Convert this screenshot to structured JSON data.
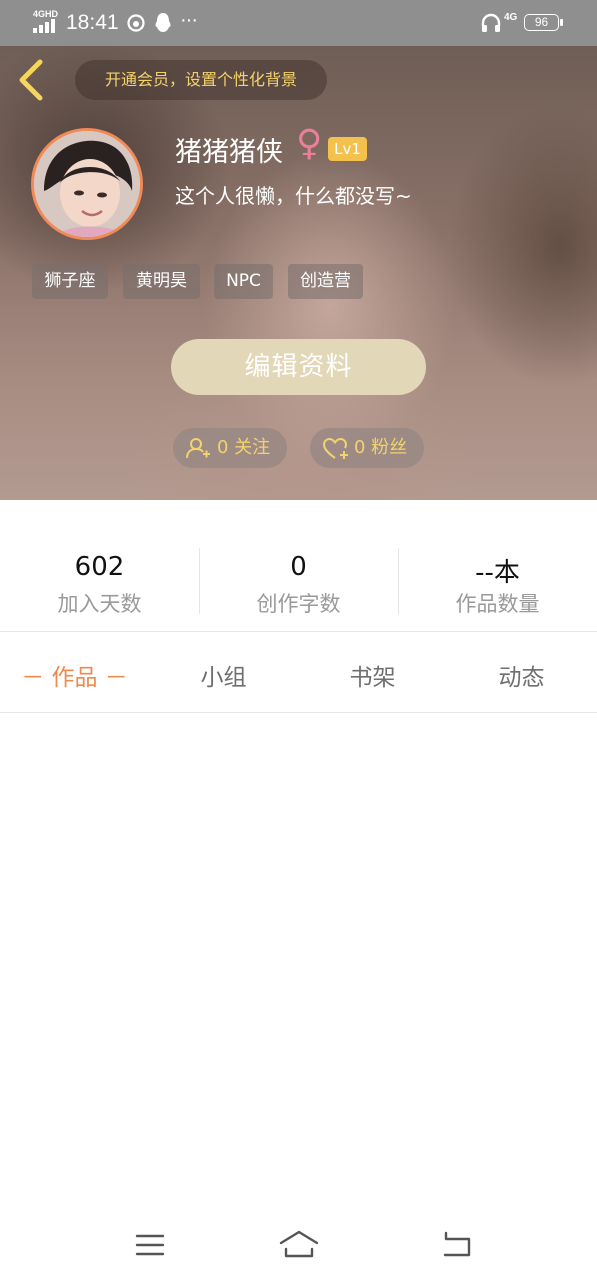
{
  "status_bar": {
    "network": "4GHD",
    "time": "18:41",
    "more": "···",
    "right_network": "4G",
    "battery": "96"
  },
  "header": {
    "vip_prompt": "开通会员，设置个性化背景",
    "username": "猪猪猪侠",
    "gender_symbol": "♀",
    "level": "Lv1",
    "bio": "这个人很懒，什么都没写~",
    "tags": [
      "狮子座",
      "黄明昊",
      "NPC",
      "创造营"
    ],
    "edit_label": "编辑资料",
    "following_label": "0 关注",
    "followers_label": "0 粉丝"
  },
  "stats": [
    {
      "value": "602",
      "label": "加入天数"
    },
    {
      "value": "0",
      "label": "创作字数"
    },
    {
      "value": "--本",
      "label": "作品数量"
    }
  ],
  "tabs": [
    {
      "label": "－ 作品 －",
      "active": true
    },
    {
      "label": "小组",
      "active": false
    },
    {
      "label": "书架",
      "active": false
    },
    {
      "label": "动态",
      "active": false
    }
  ],
  "colors": {
    "accent": "#ee8a4e",
    "gold": "#f2d36d",
    "level_badge": "#f3c14c",
    "edit_button": "#e2d7b6"
  }
}
